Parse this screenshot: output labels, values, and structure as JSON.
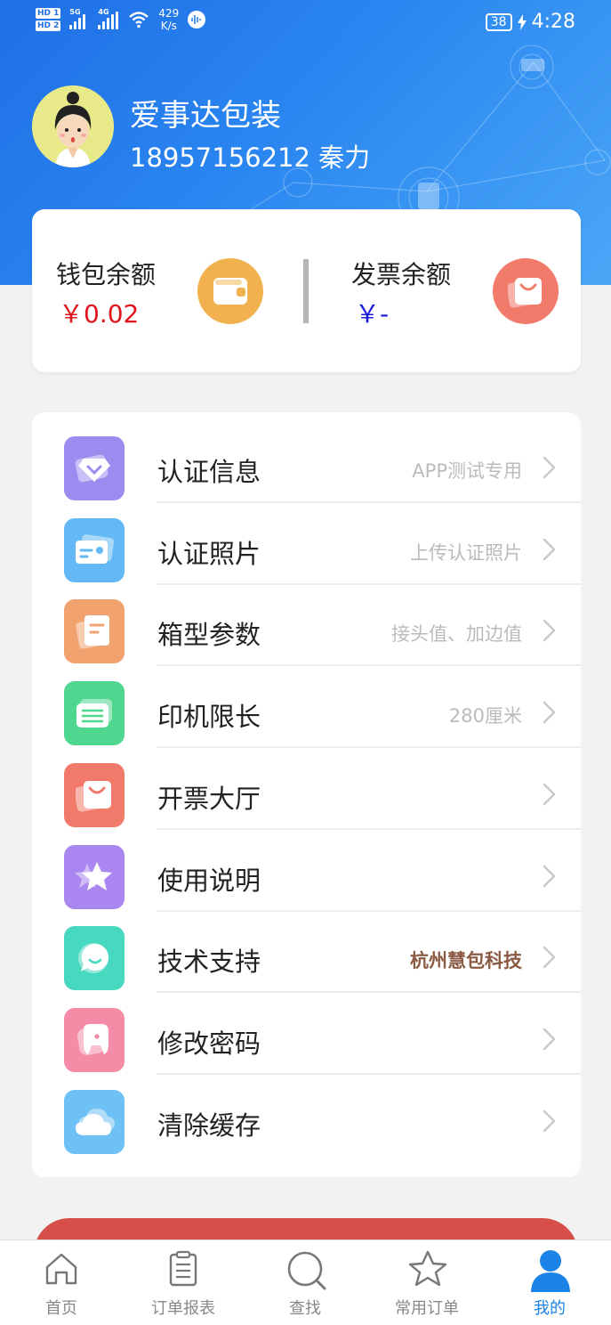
{
  "status_bar": {
    "hd1": "HD 1",
    "hd2": "HD 2",
    "sig1_label": "5G",
    "sig2_label": "4G",
    "speed_value": "429",
    "speed_unit": "K/s",
    "battery": "38",
    "time": "4:28"
  },
  "profile": {
    "company": "爱事达包装",
    "contact": "18957156212 秦力"
  },
  "balances": {
    "wallet_label": "钱包余额",
    "wallet_value": "￥0.02",
    "wallet_color": "#e0141c",
    "invoice_label": "发票余额",
    "invoice_value": "￥-",
    "invoice_color": "#1a1adb"
  },
  "menu": [
    {
      "label": "认证信息",
      "value": "APP测试专用",
      "icon": "diamond-icon",
      "color": "#9b8cf0"
    },
    {
      "label": "认证照片",
      "value": "上传认证照片",
      "icon": "id-card-icon",
      "color": "#62b9f5"
    },
    {
      "label": "箱型参数",
      "value": "接头值、加边值",
      "icon": "document-icon",
      "color": "#f2a26e"
    },
    {
      "label": "印机限长",
      "value": "280厘米",
      "icon": "list-card-icon",
      "color": "#4fd68f"
    },
    {
      "label": "开票大厅",
      "value": "",
      "icon": "shopping-bag-icon",
      "color": "#f27a6a"
    },
    {
      "label": "使用说明",
      "value": "",
      "icon": "star-icon",
      "color": "#a986f0"
    },
    {
      "label": "技术支持",
      "value": "杭州慧包科技",
      "icon": "chat-bubble-icon",
      "color": "#47d8c0"
    },
    {
      "label": "修改密码",
      "value": "",
      "icon": "tooth-icon",
      "color": "#f48ca8"
    },
    {
      "label": "清除缓存",
      "value": "",
      "icon": "cloud-icon",
      "color": "#6ec1f5"
    }
  ],
  "tabs": [
    {
      "label": "首页",
      "icon": "home-icon"
    },
    {
      "label": "订单报表",
      "icon": "clipboard-icon"
    },
    {
      "label": "查找",
      "icon": "search-icon"
    },
    {
      "label": "常用订单",
      "icon": "star-outline-icon"
    },
    {
      "label": "我的",
      "icon": "person-icon",
      "active": true
    }
  ],
  "colors": {
    "header_blue": "#2a86f0",
    "active_tab": "#1c83e6",
    "logout_red": "#d64f49"
  }
}
